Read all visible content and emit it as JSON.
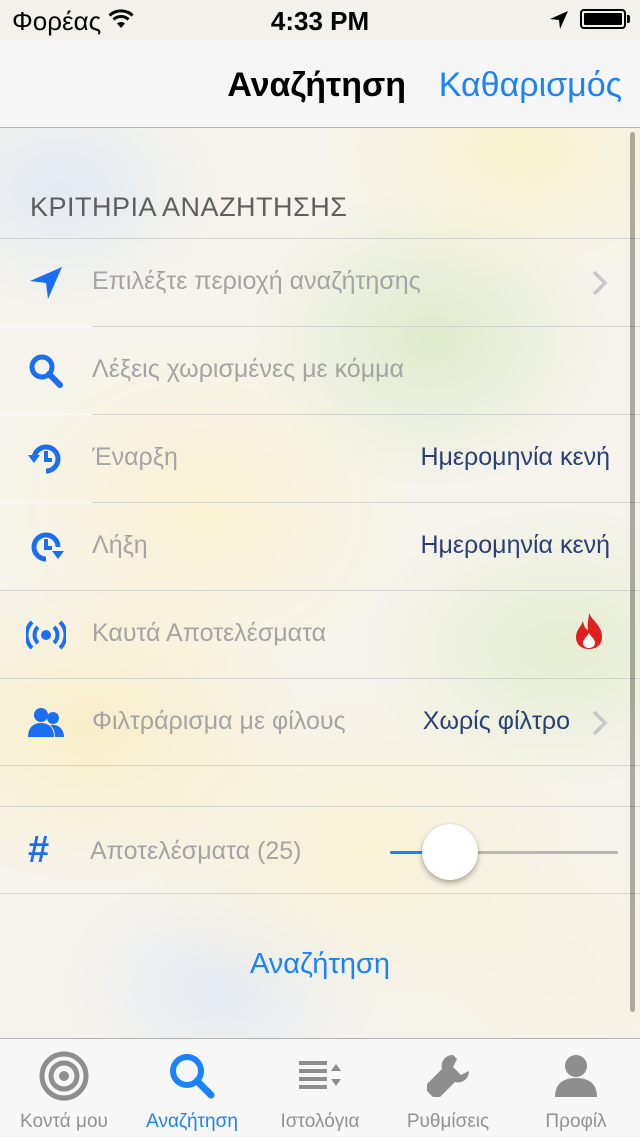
{
  "status": {
    "carrier": "Φορέας",
    "time": "4:33 PM"
  },
  "nav": {
    "title": "Αναζήτηση",
    "clear_label": "Καθαρισμός"
  },
  "section_header": "ΚΡΙΤΗΡΙΑ ΑΝΑΖΗΤΗΣΗΣ",
  "rows": [
    {
      "label": "Επιλέξτε περιοχή αναζήτησης",
      "value": ""
    },
    {
      "label": "Λέξεις χωρισμένες με κόμμα",
      "value": ""
    },
    {
      "label": "Έναρξη",
      "value": "Ημερομηνία κενή"
    },
    {
      "label": "Λήξη",
      "value": "Ημερομηνία κενή"
    },
    {
      "label": "Καυτά Αποτελέσματα",
      "value": ""
    },
    {
      "label": "Φιλτράρισμα με φίλους",
      "value": "Χωρίς φίλτρο"
    }
  ],
  "results": {
    "label": "Αποτελέσματα (25)",
    "slider_fraction": 0.2
  },
  "search_button": "Αναζήτηση",
  "tabs": [
    {
      "label": "Κοντά μου",
      "icon": "target-icon"
    },
    {
      "label": "Αναζήτηση",
      "icon": "search-icon"
    },
    {
      "label": "Ιστολόγια",
      "icon": "list-sort-icon"
    },
    {
      "label": "Ρυθμίσεις",
      "icon": "wrench-icon"
    },
    {
      "label": "Προφίλ",
      "icon": "person-icon"
    }
  ],
  "colors": {
    "accent": "#1a82fb",
    "value_text": "#2b3f77",
    "hot": "#e02020"
  }
}
